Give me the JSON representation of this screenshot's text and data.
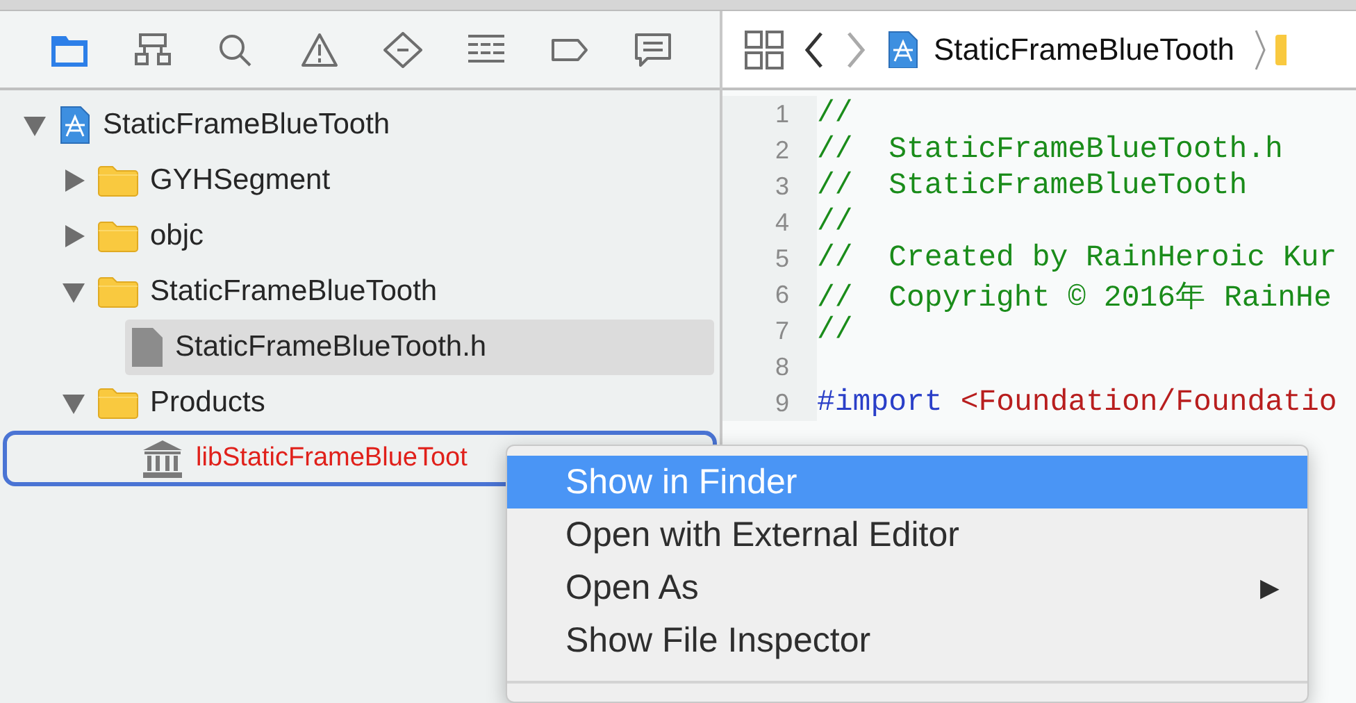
{
  "navigator_tabs": [
    {
      "kind": "project",
      "selected": true
    },
    {
      "kind": "symbol",
      "selected": false
    },
    {
      "kind": "find",
      "selected": false
    },
    {
      "kind": "issue",
      "selected": false
    },
    {
      "kind": "test",
      "selected": false
    },
    {
      "kind": "debug",
      "selected": false
    },
    {
      "kind": "breakpoint",
      "selected": false
    },
    {
      "kind": "report",
      "selected": false
    }
  ],
  "tree": [
    {
      "name": "StaticFrameBlueTooth",
      "kind": "project",
      "expanded": true,
      "selected": false,
      "children": [
        {
          "name": "GYHSegment",
          "kind": "folder",
          "expanded": false,
          "selected": false
        },
        {
          "name": "objc",
          "kind": "folder",
          "expanded": false,
          "selected": false
        },
        {
          "name": "StaticFrameBlueTooth",
          "kind": "folder",
          "expanded": true,
          "selected": false,
          "children": [
            {
              "name": "StaticFrameBlueTooth.h",
              "kind": "header",
              "selected": true
            }
          ]
        },
        {
          "name": "Products",
          "kind": "folder",
          "expanded": true,
          "selected": false,
          "children": [
            {
              "name": "libStaticFrameBlueToot",
              "kind": "library",
              "selected": false,
              "focused": true,
              "missing": true
            }
          ]
        }
      ]
    }
  ],
  "jump_bar": {
    "path": [
      "StaticFrameBlueTooth"
    ]
  },
  "editor": {
    "lines": [
      {
        "number": "1",
        "text": "//",
        "kind": "comment"
      },
      {
        "number": "2",
        "text": "//  StaticFrameBlueTooth.h",
        "kind": "comment"
      },
      {
        "number": "3",
        "text": "//  StaticFrameBlueTooth",
        "kind": "comment"
      },
      {
        "number": "4",
        "text": "//",
        "kind": "comment"
      },
      {
        "number": "5",
        "text": "//  Created by RainHeroic Kur",
        "kind": "comment"
      },
      {
        "number": "6",
        "text": "//  Copyright © 2016年 RainHe",
        "kind": "comment"
      },
      {
        "number": "7",
        "text": "//",
        "kind": "comment"
      },
      {
        "number": "8",
        "kind": "blank"
      },
      {
        "number": "9",
        "directive": "#import",
        "path": "<Foundation/Foundatio",
        "kind": "import"
      }
    ]
  },
  "context_menu": {
    "items": [
      {
        "label": "Show in Finder",
        "selected": true
      },
      {
        "label": "Open with External Editor",
        "selected": false
      },
      {
        "label": "Open As",
        "selected": false,
        "arrow": "▶"
      },
      {
        "label": "Show File Inspector",
        "selected": false
      }
    ]
  }
}
